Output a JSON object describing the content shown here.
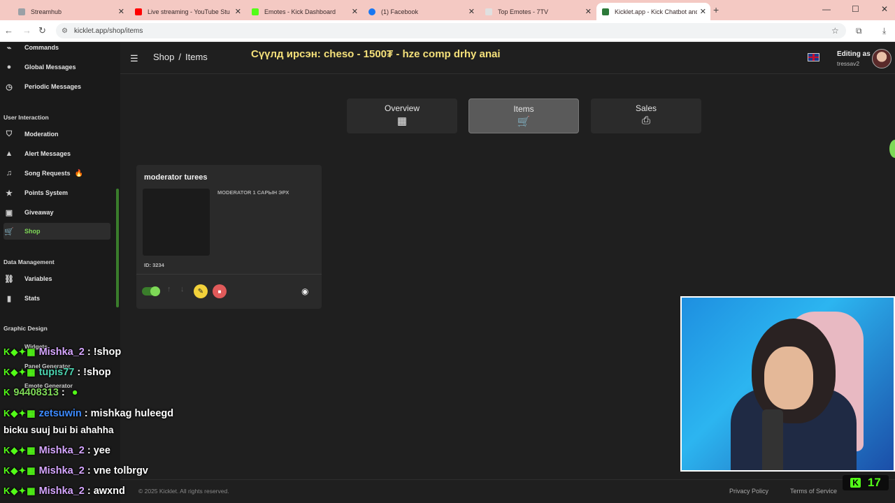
{
  "browser": {
    "tabs": [
      {
        "label": "Streamhub",
        "fav_color": "#9aa0a6",
        "active": false
      },
      {
        "label": "Live streaming - YouTube Studio",
        "fav_color": "#ff0000",
        "active": false
      },
      {
        "label": "Emotes - Kick Dashboard",
        "fav_color": "#53fc18",
        "active": false
      },
      {
        "label": "(1) Facebook",
        "fav_color": "#1877f2",
        "active": false
      },
      {
        "label": "Top Emotes - 7TV",
        "fav_color": "#e0e0e0",
        "active": false
      },
      {
        "label": "Kicklet.app - Kick Chatbot and Overlays",
        "fav_color": "#2d7a3a",
        "active": true
      }
    ],
    "url": "kicklet.app/shop/items"
  },
  "sidebar": {
    "items_top": [
      {
        "label": "Commands",
        "icon": "slash-icon"
      },
      {
        "label": "Global Messages",
        "icon": "chat-bubble-icon"
      },
      {
        "label": "Periodic Messages",
        "icon": "clock-icon"
      }
    ],
    "section_user_interaction": "User Interaction",
    "items_user": [
      {
        "label": "Moderation",
        "icon": "shield-icon"
      },
      {
        "label": "Alert Messages",
        "icon": "warning-icon"
      },
      {
        "label": "Song Requests",
        "icon": "music-note-icon"
      },
      {
        "label": "Points System",
        "icon": "star-icon"
      },
      {
        "label": "Giveaway",
        "icon": "gift-icon"
      },
      {
        "label": "Shop",
        "icon": "cart-icon"
      }
    ],
    "section_data": "Data Management",
    "items_data": [
      {
        "label": "Variables",
        "icon": "link-icon"
      },
      {
        "label": "Stats",
        "icon": "bar-chart-icon"
      }
    ],
    "section_graphic": "Graphic Design",
    "items_graphic": [
      {
        "label": "Widgets"
      },
      {
        "label": "Panel Generator"
      },
      {
        "label": "Emote Generator"
      }
    ],
    "active_color": "#7ed957"
  },
  "topbar": {
    "breadcrumb_root": "Shop",
    "breadcrumb_sep": "/",
    "breadcrumb_current": "Items",
    "ticker": "Сүүлд ирсэн: cheso - 1500₮ - hze comp drhy anai",
    "editing_as": "Editing as",
    "username": "tressav2"
  },
  "shop_tabs": [
    {
      "label": "Overview",
      "icon": "▦",
      "selected": false
    },
    {
      "label": "Items",
      "icon": "🛒",
      "selected": true
    },
    {
      "label": "Sales",
      "icon": "⎙",
      "selected": false
    }
  ],
  "item": {
    "title": "moderator turees",
    "description": "MODERATOR 1 САРЫН ЭРХ",
    "id_text": "ID: 3234",
    "enabled": true
  },
  "chat": [
    {
      "user": "Mishka_2",
      "user_color": "#d6a6ff",
      "text": ": !shop",
      "badges": true
    },
    {
      "user": "tupis77",
      "user_color": "#4cd4b0",
      "text": ": !shop",
      "badges": true
    },
    {
      "user": "94408313",
      "user_color": "#7ed957",
      "text": ":",
      "badges": true
    },
    {
      "user": "zetsuwin",
      "user_color": "#3d8bff",
      "text": ": mishkag huleegd",
      "badges": true
    },
    {
      "user": "",
      "user_color": "#ffffff",
      "text": "bicku suuj bui bi ahahha",
      "badges": false
    },
    {
      "user": "Mishka_2",
      "user_color": "#d6a6ff",
      "text": ": yee",
      "badges": true
    },
    {
      "user": "Mishka_2",
      "user_color": "#d6a6ff",
      "text": ": vne tolbrgv",
      "badges": true
    },
    {
      "user": "Mishka_2",
      "user_color": "#d6a6ff",
      "text": ": awxnd",
      "badges": true
    }
  ],
  "footer": {
    "copyright": "© 2025 Kicklet. All rights reserved.",
    "privacy": "Privacy Policy",
    "terms": "Terms of Service"
  },
  "viewers": {
    "count": "17",
    "logo": "K"
  }
}
